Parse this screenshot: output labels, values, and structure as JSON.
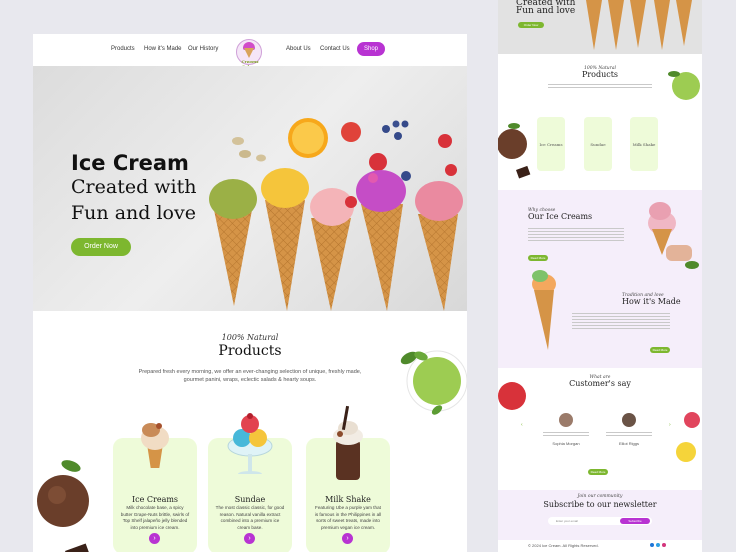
{
  "nav": {
    "items": [
      "Products",
      "How it's Made",
      "Our History",
      "About Us",
      "Contact Us"
    ],
    "shop_label": "Shop",
    "logo_text": "Creams Cabana"
  },
  "hero": {
    "title_line1": "Ice Cream",
    "title_line2": "Created with",
    "title_line3": "Fun and love",
    "cta": "Order Now"
  },
  "products": {
    "kicker": "100% Natural",
    "title": "Products",
    "description": "Prepared fresh every morning, we offer an ever-changing selection of unique, freshly made, gourmet panini, wraps, eclectic salads & hearty soups.",
    "cards": [
      {
        "title": "Ice Creams",
        "desc": "Milk chocolate base, a spicy butter Grape-Nuts brittle, swirls of Top Shelf jalapeño jelly blended into premium ice cream."
      },
      {
        "title": "Sundae",
        "desc": "The most classic classic, for good reason. Natural vanilla extract combined into a premium ice cream base."
      },
      {
        "title": "Milk Shake",
        "desc": "Featuring Ube a purple yam that is famous in the Philippines in all sorts of sweet treats, made into premium vegan ice cream."
      }
    ]
  },
  "secondary": {
    "hero_line1": "Created with",
    "hero_line2": "Fun and love",
    "hero_cta": "Order Now",
    "products_kicker": "100% Natural",
    "products_title": "Products",
    "card_titles": [
      "Ice Creams",
      "Sundae",
      "Milk Shake"
    ],
    "why_kicker": "Why choose",
    "why_title": "Our Ice Creams",
    "why_cta": "Read More",
    "made_kicker": "Tradition and love",
    "made_title": "How it's Made",
    "made_cta": "Read More",
    "test_kicker": "What are",
    "test_title": "Customer's say",
    "test_names": [
      "Sophia Morgan",
      "Elliot Riggs"
    ],
    "test_cta": "Read More",
    "news_kicker": "Join our community",
    "news_title": "Subscribe to our newsletter",
    "news_placeholder": "Enter your email",
    "news_btn": "Subscribe",
    "footer": "© 2024 Ice Cream. All Rights Reserved."
  },
  "colors": {
    "accent_purple": "#b833d2",
    "accent_green": "#7db72f",
    "card_bg": "#eefbd9"
  }
}
